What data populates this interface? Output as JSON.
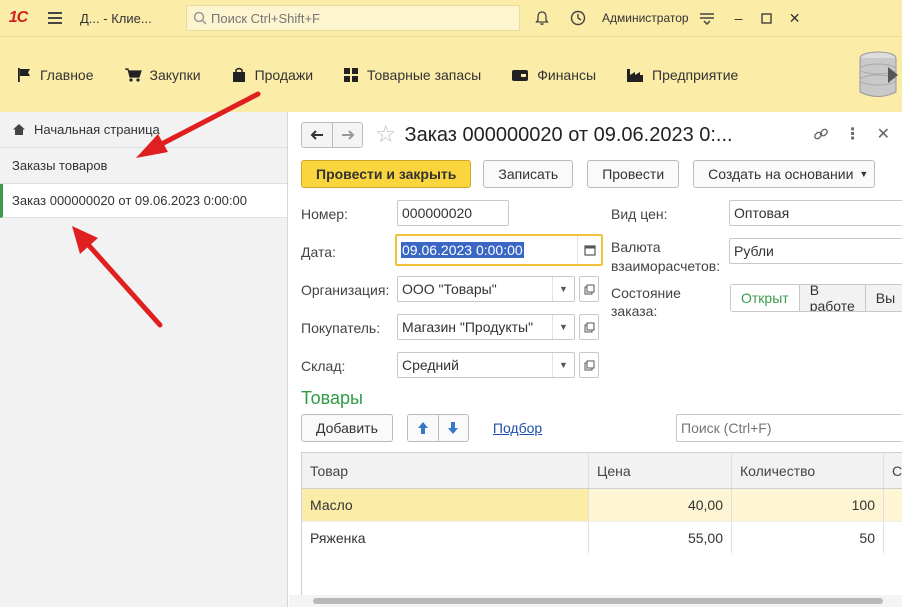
{
  "app": {
    "logo_text": "1С",
    "title": "Д...   - Клие...",
    "search_placeholder": "Поиск Ctrl+Shift+F",
    "user": "Администратор"
  },
  "sections": [
    {
      "label": "Главное",
      "icon": "flag-icon"
    },
    {
      "label": "Закупки",
      "icon": "cart-icon"
    },
    {
      "label": "Продажи",
      "icon": "bag-icon"
    },
    {
      "label": "Товарные запасы",
      "icon": "grid-icon"
    },
    {
      "label": "Финансы",
      "icon": "wallet-icon"
    },
    {
      "label": "Предприятие",
      "icon": "factory-icon"
    }
  ],
  "sidebar": {
    "home": "Начальная страница",
    "orders": "Заказы товаров",
    "open_doc": "Заказ 000000020 от 09.06.2023 0:00:00"
  },
  "document": {
    "title": "Заказ 000000020 от 09.06.2023 0:...",
    "toolbar": {
      "post_close": "Провести и закрыть",
      "save": "Записать",
      "post": "Провести",
      "create_based": "Создать на основании"
    },
    "fields": {
      "number_label": "Номер:",
      "number_value": "000000020",
      "date_label": "Дата:",
      "date_value": "09.06.2023  0:00:00",
      "org_label": "Организация:",
      "org_value": "ООО \"Товары\"",
      "buyer_label": "Покупатель:",
      "buyer_value": "Магазин \"Продукты\"",
      "warehouse_label": "Склад:",
      "warehouse_value": "Средний",
      "price_type_label": "Вид цен:",
      "price_type_value": "Оптовая",
      "currency_label_1": "Валюта",
      "currency_label_2": "взаиморасчетов:",
      "currency_value": "Рубли",
      "state_label_1": "Состояние",
      "state_label_2": "заказа:",
      "states": [
        "Открыт",
        "В работе",
        "Вы"
      ]
    },
    "goods": {
      "title": "Товары",
      "add": "Добавить",
      "pick": "Подбор",
      "search_placeholder": "Поиск (Ctrl+F)",
      "columns": [
        "Товар",
        "Цена",
        "Количество",
        "С"
      ],
      "rows": [
        {
          "item": "Масло",
          "price": "40,00",
          "qty": "100"
        },
        {
          "item": "Ряженка",
          "price": "55,00",
          "qty": "50"
        }
      ]
    }
  },
  "colors": {
    "header_bg": "#fbeca8",
    "primary_button": "#fbd53d",
    "accent_green": "#2e9b45",
    "annotation_red": "#e02020"
  }
}
